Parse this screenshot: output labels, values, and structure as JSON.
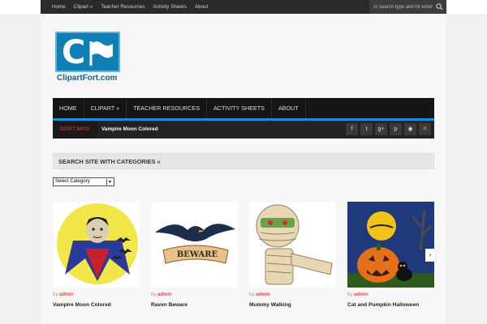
{
  "topbar": {
    "nav": [
      "Home",
      "Clipart",
      "Teacher Resources",
      "Activity Sheets",
      "About"
    ],
    "search_placeholder": "To search type and hit enter"
  },
  "logo": {
    "text": "ClipartFort.com"
  },
  "mainnav": [
    "HOME",
    "CLIPART »",
    "TEACHER RESOURCES",
    "ACTIVITY SHEETS",
    "ABOUT"
  ],
  "ticker": {
    "label": "DON'T MISS",
    "headline": "Vampire Moon Colored"
  },
  "social": [
    "f",
    "t",
    "g+",
    "p",
    "rss",
    "shuffle"
  ],
  "categories": {
    "heading": "SEARCH SITE WITH CATEGORIES »",
    "select_value": "Select Category"
  },
  "posts": [
    {
      "by": "by",
      "author": "admin",
      "title": "Vampire Moon Colored"
    },
    {
      "by": "by",
      "author": "admin",
      "title": "Raven Beware"
    },
    {
      "by": "by",
      "author": "admin",
      "title": "Mummy Walking"
    },
    {
      "by": "by",
      "author": "admin",
      "title": "Cat and Pumpkin Halloween"
    }
  ],
  "beware_sign": "BEWARE",
  "colors": {
    "accent": "#1e8fd6",
    "red": "#e84b3c",
    "dark": "#141414"
  }
}
